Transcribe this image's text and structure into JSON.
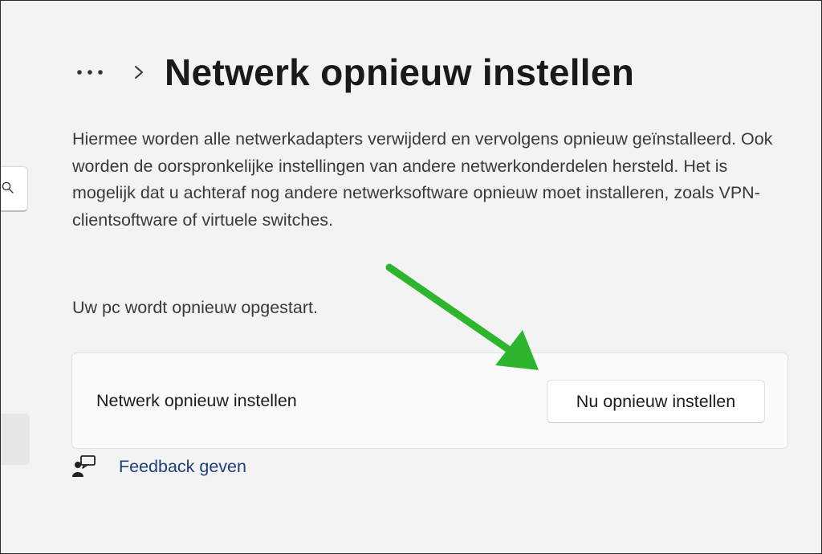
{
  "header": {
    "more_icon": "more-horizontal-icon",
    "separator_icon": "chevron-right-icon",
    "title": "Netwerk opnieuw instellen"
  },
  "description": "Hiermee worden alle netwerkadapters verwijderd en vervolgens opnieuw geïnstalleerd. Ook worden de oorspronkelijke instellingen van andere netwerkonderdelen hersteld. Het is mogelijk dat u achteraf nog andere netwerksoftware opnieuw moet installeren, zoals VPN-clientsoftware of virtuele switches.",
  "restart_note": "Uw pc wordt opnieuw opgestart.",
  "reset_card": {
    "label": "Netwerk opnieuw instellen",
    "button_label": "Nu opnieuw instellen"
  },
  "feedback": {
    "icon": "feedback-person-icon",
    "label": "Feedback geven"
  },
  "sidebar_remnants": {
    "search_icon": "search-icon"
  },
  "annotation": {
    "arrow_color": "#2db52d"
  },
  "colors": {
    "background": "#f3f3f3",
    "card": "#fbfbfb",
    "link": "#1f3f7a"
  }
}
